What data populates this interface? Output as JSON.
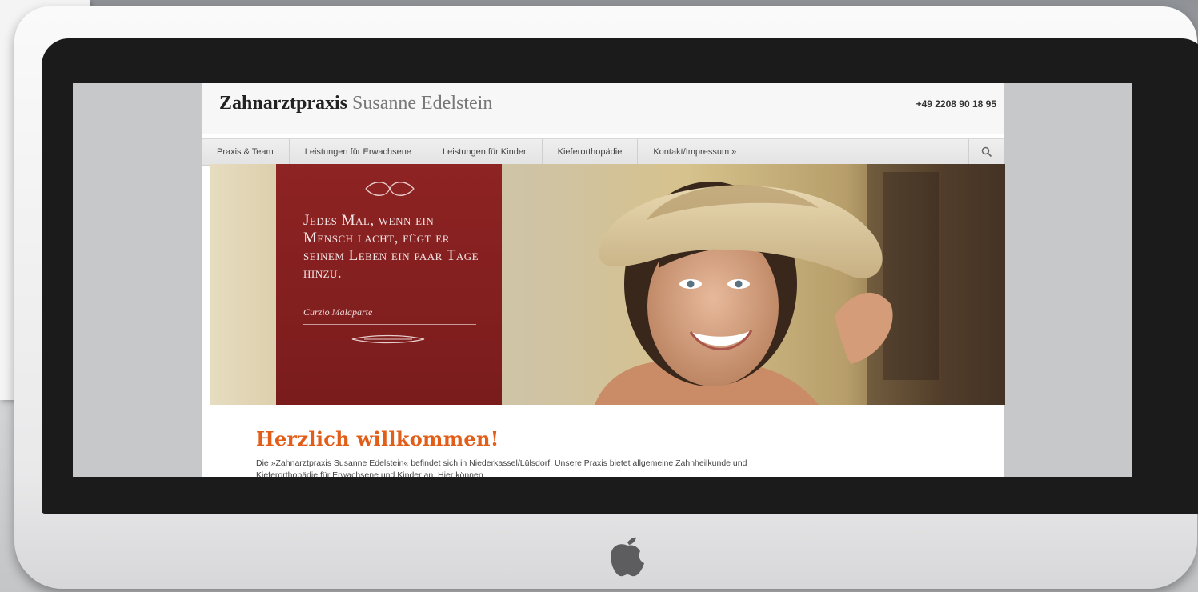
{
  "site": {
    "title_first": "Zahnarztpraxis",
    "title_last": "Susanne Edelstein",
    "phone": "+49 2208 90 18 95"
  },
  "nav": {
    "items": [
      {
        "label": "Praxis & Team"
      },
      {
        "label": "Leistungen für Erwachsene"
      },
      {
        "label": "Leistungen für Kinder"
      },
      {
        "label": "Kieferorthopädie"
      },
      {
        "label": "Kontakt/Impressum »"
      }
    ],
    "search_icon": "search-icon"
  },
  "hero": {
    "quote": "Jedes Mal, wenn ein Mensch lacht, fügt er seinem Leben ein paar Tage hinzu.",
    "author": "Curzio Malaparte",
    "accent_color": "#8e2323"
  },
  "content": {
    "heading": "Herzlich willkommen!",
    "intro": "Die »Zahnarztpraxis Susanne Edelstein« befindet sich in Niederkassel/Lülsdorf. Unsere Praxis bietet allgemeine Zahnheilkunde und Kieferorthopädie für Erwachsene und Kinder an. Hier können",
    "heading_color": "#e25e18"
  },
  "device": {
    "logo_icon": "apple-logo-icon"
  }
}
